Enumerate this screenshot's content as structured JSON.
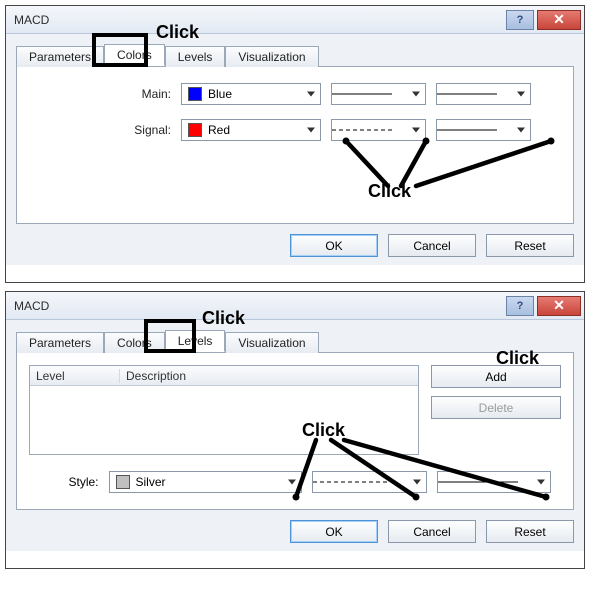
{
  "dialog1": {
    "title": "MACD",
    "tabs": [
      "Parameters",
      "Colors",
      "Levels",
      "Visualization"
    ],
    "activeTab": "Colors",
    "rows": {
      "main": {
        "label": "Main:",
        "colorName": "Blue",
        "colorHex": "#0000ff"
      },
      "signal": {
        "label": "Signal:",
        "colorName": "Red",
        "colorHex": "#ff0000"
      }
    },
    "buttons": {
      "ok": "OK",
      "cancel": "Cancel",
      "reset": "Reset"
    }
  },
  "dialog2": {
    "title": "MACD",
    "tabs": [
      "Parameters",
      "Colors",
      "Levels",
      "Visualization"
    ],
    "activeTab": "Levels",
    "listHeaders": {
      "level": "Level",
      "description": "Description"
    },
    "sideButtons": {
      "add": "Add",
      "delete": "Delete"
    },
    "style": {
      "label": "Style:",
      "colorName": "Silver",
      "colorHex": "#c0c0c0"
    },
    "buttons": {
      "ok": "OK",
      "cancel": "Cancel",
      "reset": "Reset"
    }
  },
  "annotations": {
    "click": "Click"
  }
}
